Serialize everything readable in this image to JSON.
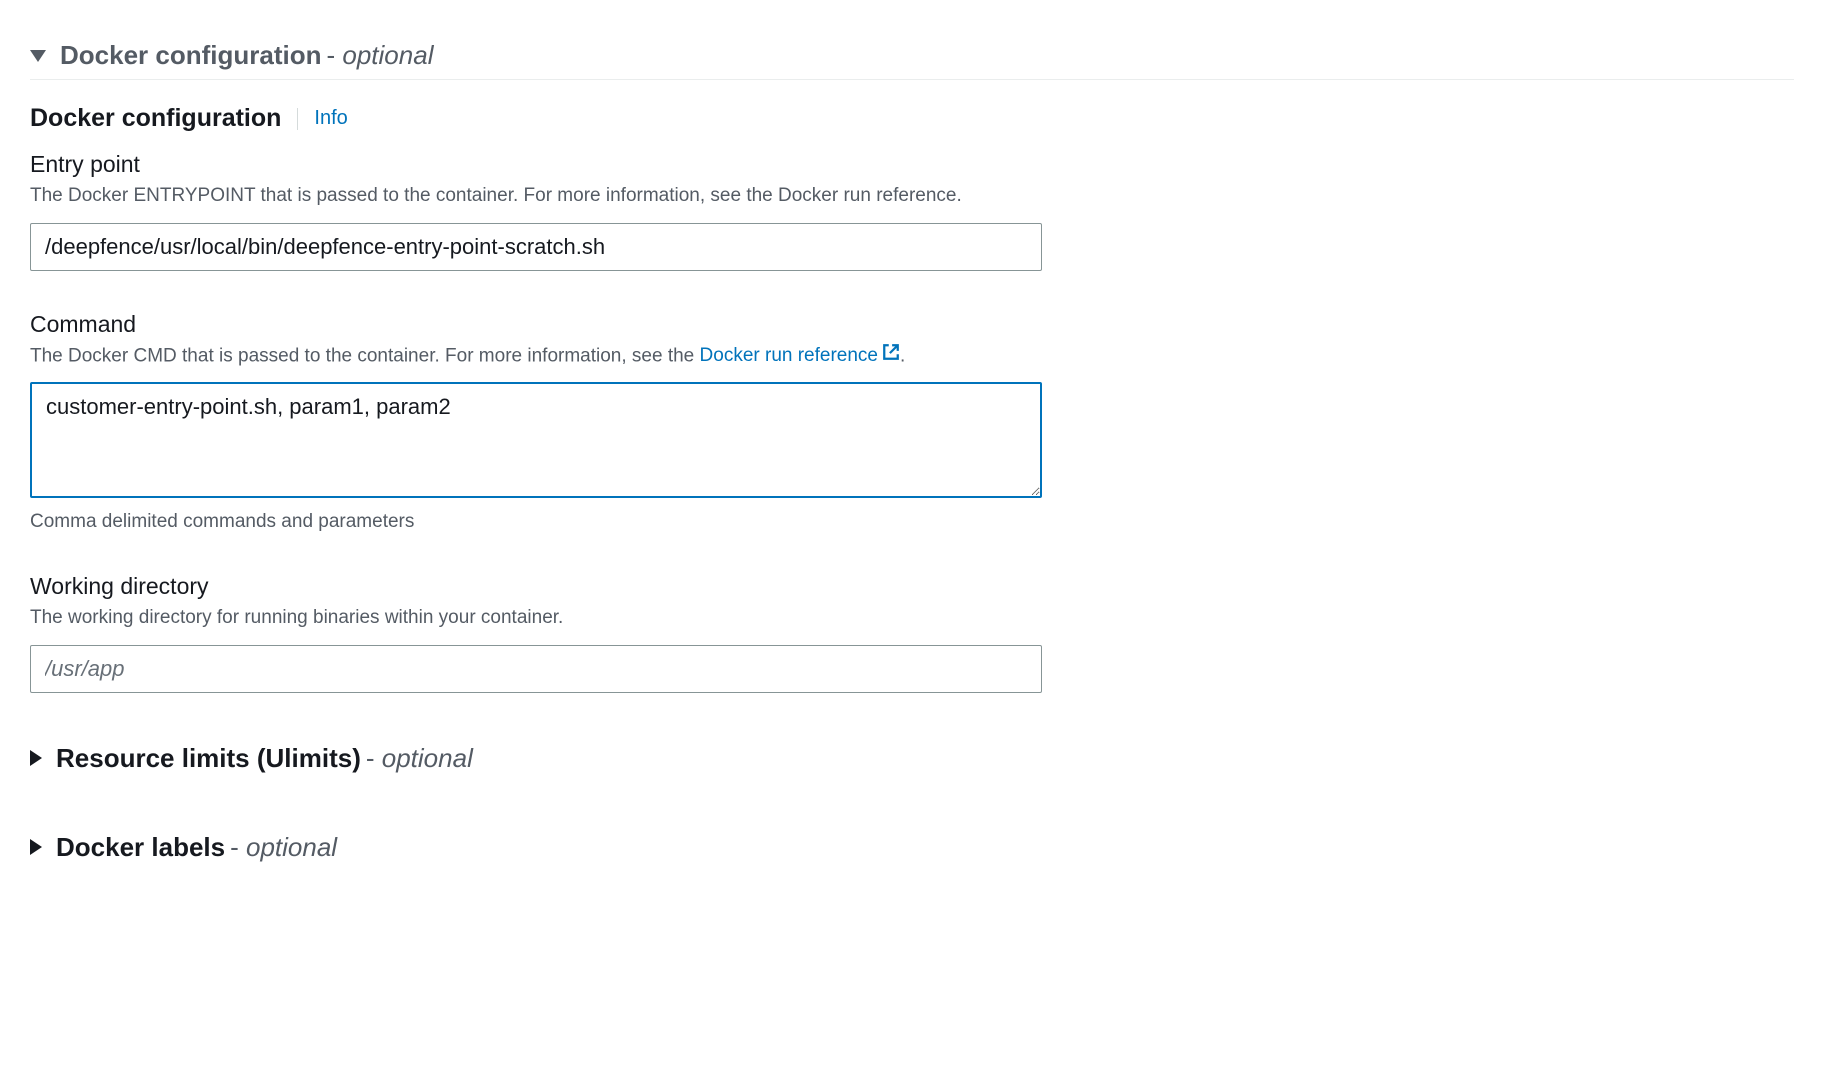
{
  "sections": {
    "dockerConfig": {
      "title": "Docker configuration",
      "optional": "optional",
      "subsectionTitle": "Docker configuration",
      "infoLabel": "Info"
    },
    "resourceLimits": {
      "title": "Resource limits (Ulimits)",
      "optional": "optional"
    },
    "dockerLabels": {
      "title": "Docker labels",
      "optional": "optional"
    }
  },
  "fields": {
    "entryPoint": {
      "label": "Entry point",
      "description": "The Docker ENTRYPOINT that is passed to the container. For more information, see the Docker run reference.",
      "value": "/deepfence/usr/local/bin/deepfence-entry-point-scratch.sh"
    },
    "command": {
      "label": "Command",
      "descPrefix": "The Docker CMD that is passed to the container. For more information, see the ",
      "linkText": "Docker run reference",
      "descSuffix": ".",
      "value": "customer-entry-point.sh, param1, param2",
      "helper": "Comma delimited commands and parameters"
    },
    "workingDir": {
      "label": "Working directory",
      "description": "The working directory for running binaries within your container.",
      "placeholder": "/usr/app",
      "value": ""
    }
  }
}
